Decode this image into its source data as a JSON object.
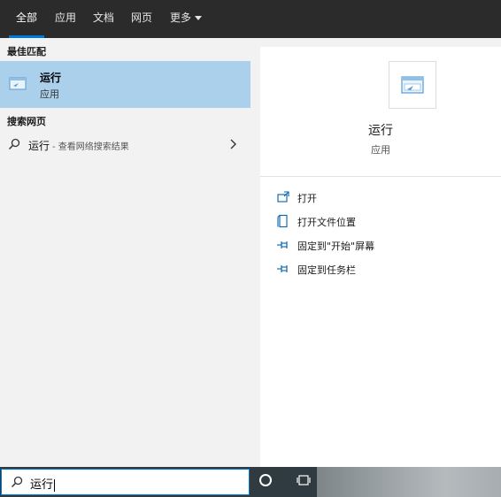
{
  "tabs": [
    {
      "label": "全部",
      "active": true
    },
    {
      "label": "应用"
    },
    {
      "label": "文档"
    },
    {
      "label": "网页"
    },
    {
      "label": "更多"
    }
  ],
  "left": {
    "best_match_heading": "最佳匹配",
    "best_match": {
      "title": "运行",
      "subtitle": "应用",
      "icon": "run-app-icon"
    },
    "web_heading": "搜索网页",
    "web_item": {
      "query": "运行",
      "suffix": "- 查看网络搜索结果",
      "icon": "search-icon"
    }
  },
  "right": {
    "app_title": "运行",
    "app_subtitle": "应用",
    "actions": [
      {
        "label": "打开",
        "icon": "open-icon"
      },
      {
        "label": "打开文件位置",
        "icon": "file-location-icon"
      },
      {
        "label": "固定到\"开始\"屏幕",
        "icon": "pin-icon"
      },
      {
        "label": "固定到任务栏",
        "icon": "pin-icon"
      }
    ]
  },
  "taskbar": {
    "search_value": "运行",
    "search_icon": "search-icon",
    "cortana_icon": "cortana-icon",
    "task_view_icon": "task-view-icon"
  },
  "colors": {
    "topbar": "#2b2b2b",
    "accent": "#0078d7",
    "selection": "#abd0ec",
    "panel": "#f2f2f2"
  }
}
